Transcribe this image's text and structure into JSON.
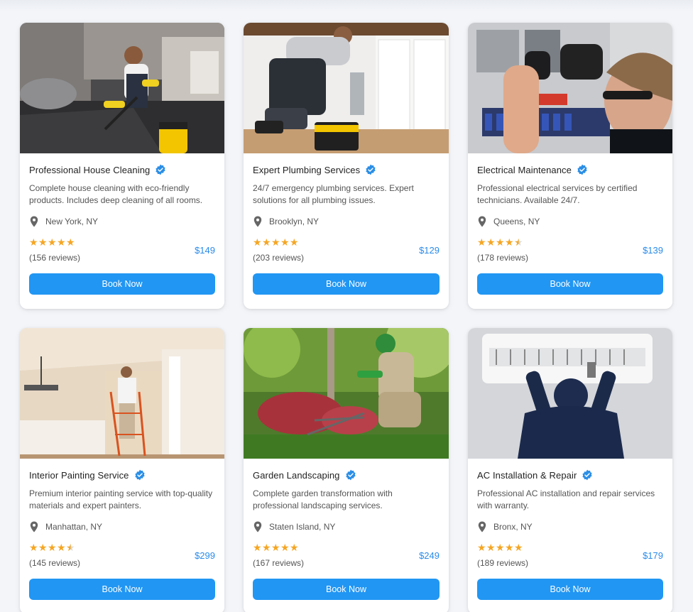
{
  "colors": {
    "accent": "#2196f3",
    "price": "#2a8bea",
    "star": "#f5a623",
    "verified": "#2b8ee6"
  },
  "services": [
    {
      "title": "Professional House Cleaning",
      "description": "Complete house cleaning with eco-friendly products. Includes deep cleaning of all rooms.",
      "location": "New York, NY",
      "rating": 5,
      "reviews": "(156 reviews)",
      "price": "$149",
      "button": "Book Now",
      "image": "house-cleaning-photo"
    },
    {
      "title": "Expert Plumbing Services",
      "description": "24/7 emergency plumbing services. Expert solutions for all plumbing issues.",
      "location": "Brooklyn, NY",
      "rating": 5,
      "reviews": "(203 reviews)",
      "price": "$129",
      "button": "Book Now",
      "image": "plumbing-photo"
    },
    {
      "title": "Electrical Maintenance",
      "description": "Professional electrical services by certified technicians. Available 24/7.",
      "location": "Queens, NY",
      "rating": 4.5,
      "reviews": "(178 reviews)",
      "price": "$139",
      "button": "Book Now",
      "image": "electrical-photo"
    },
    {
      "title": "Interior Painting Service",
      "description": "Premium interior painting service with top-quality materials and expert painters.",
      "location": "Manhattan, NY",
      "rating": 4.5,
      "reviews": "(145 reviews)",
      "price": "$299",
      "button": "Book Now",
      "image": "painting-photo"
    },
    {
      "title": "Garden Landscaping",
      "description": "Complete garden transformation with professional landscaping services.",
      "location": "Staten Island, NY",
      "rating": 5,
      "reviews": "(167 reviews)",
      "price": "$249",
      "button": "Book Now",
      "image": "landscaping-photo"
    },
    {
      "title": "AC Installation & Repair",
      "description": "Professional AC installation and repair services with warranty.",
      "location": "Bronx, NY",
      "rating": 5,
      "reviews": "(189 reviews)",
      "price": "$179",
      "button": "Book Now",
      "image": "ac-repair-photo"
    }
  ]
}
